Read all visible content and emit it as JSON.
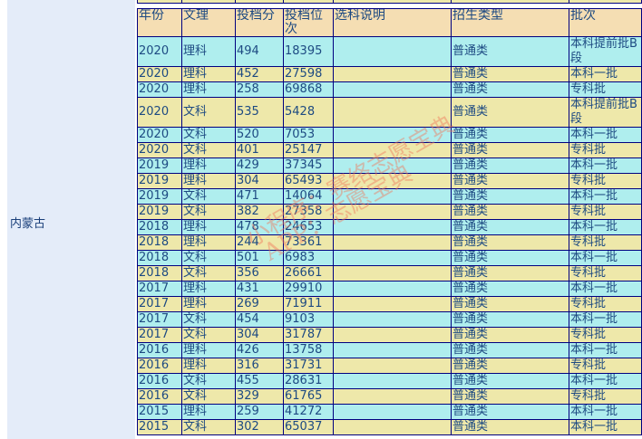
{
  "province": "内蒙古",
  "headers": [
    "年份",
    "文理",
    "投档分",
    "投档位次",
    "选科说明",
    "招生类型",
    "批次"
  ],
  "rows": [
    [
      "2020",
      "理科",
      "494",
      "18395",
      "",
      "普通类",
      "本科提前批B段"
    ],
    [
      "2020",
      "理科",
      "452",
      "27598",
      "",
      "普通类",
      "本科一批"
    ],
    [
      "2020",
      "理科",
      "258",
      "69868",
      "",
      "普通类",
      "专科批"
    ],
    [
      "2020",
      "文科",
      "535",
      "5428",
      "",
      "普通类",
      "本科提前批B段"
    ],
    [
      "2020",
      "文科",
      "520",
      "7053",
      "",
      "普通类",
      "本科一批"
    ],
    [
      "2020",
      "文科",
      "401",
      "25147",
      "",
      "普通类",
      "专科批"
    ],
    [
      "2019",
      "理科",
      "429",
      "37345",
      "",
      "普通类",
      "本科一批"
    ],
    [
      "2019",
      "理科",
      "304",
      "65493",
      "",
      "普通类",
      "专科批"
    ],
    [
      "2019",
      "文科",
      "471",
      "14064",
      "",
      "普通类",
      "本科一批"
    ],
    [
      "2019",
      "文科",
      "382",
      "27358",
      "",
      "普通类",
      "专科批"
    ],
    [
      "2018",
      "理科",
      "478",
      "24653",
      "",
      "普通类",
      "本科一批"
    ],
    [
      "2018",
      "理科",
      "244",
      "73361",
      "",
      "普通类",
      "专科批"
    ],
    [
      "2018",
      "文科",
      "501",
      "6983",
      "",
      "普通类",
      "本科一批"
    ],
    [
      "2018",
      "文科",
      "356",
      "26661",
      "",
      "普通类",
      "专科批"
    ],
    [
      "2017",
      "理科",
      "431",
      "29910",
      "",
      "普通类",
      "本科一批"
    ],
    [
      "2017",
      "理科",
      "269",
      "71911",
      "",
      "普通类",
      "专科批"
    ],
    [
      "2017",
      "文科",
      "454",
      "9103",
      "",
      "普通类",
      "本科一批"
    ],
    [
      "2017",
      "文科",
      "304",
      "31787",
      "",
      "普通类",
      "专科批"
    ],
    [
      "2016",
      "理科",
      "426",
      "13758",
      "",
      "普通类",
      "本科一批"
    ],
    [
      "2016",
      "理科",
      "316",
      "31731",
      "",
      "普通类",
      "专科批"
    ],
    [
      "2016",
      "文科",
      "455",
      "28631",
      "",
      "普通类",
      "本科一批"
    ],
    [
      "2016",
      "文科",
      "329",
      "61765",
      "",
      "普通类",
      "专科批"
    ],
    [
      "2015",
      "理科",
      "259",
      "41272",
      "",
      "普通类",
      "本科一批"
    ],
    [
      "2015",
      "文科",
      "302",
      "65037",
      "",
      "普通类",
      "本科一批"
    ]
  ],
  "watermark": {
    "line1": "小程序：赛络志愿宝典",
    "line2": "APP：志愿宝典"
  }
}
